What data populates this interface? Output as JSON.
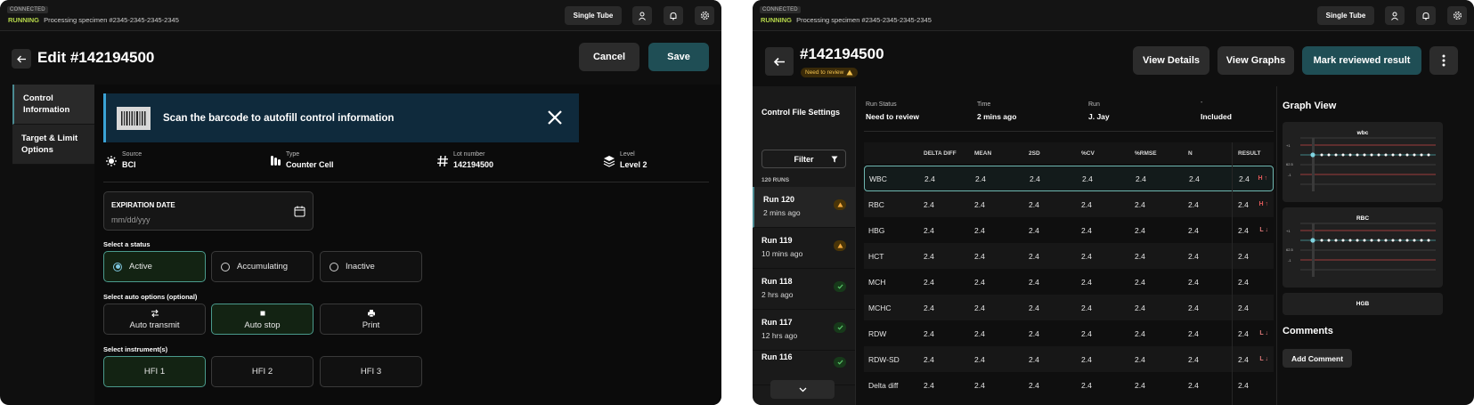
{
  "left": {
    "topbar": {
      "connected": "CONNECTED",
      "running": "RUNNING",
      "status": "Processing specimen #2345-2345-2345-2345",
      "mode_button": "Single Tube"
    },
    "header": {
      "title": "Edit #142194500",
      "cancel": "Cancel",
      "save": "Save"
    },
    "nav": [
      "Control Information",
      "Target & Limit Options"
    ],
    "banner": {
      "text": "Scan the barcode to autofill control information"
    },
    "meta": [
      {
        "label": "Source",
        "value": "BCI",
        "icon": "source-icon"
      },
      {
        "label": "Type",
        "value": "Counter Cell",
        "icon": "tubes-icon"
      },
      {
        "label": "Lot number",
        "value": "142194500",
        "icon": "hash-icon"
      },
      {
        "label": "Level",
        "value": "Level 2",
        "icon": "layers-icon"
      }
    ],
    "expiration": {
      "label": "EXPIRATION DATE",
      "placeholder": "mm/dd/yyy"
    },
    "status": {
      "label": "Select a status",
      "options": [
        "Active",
        "Accumulating",
        "Inactive"
      ],
      "selected": "Active"
    },
    "auto": {
      "label": "Select auto options (optional)",
      "options": [
        "Auto transmit",
        "Auto stop",
        "Print"
      ],
      "selected": "Auto stop"
    },
    "instruments": {
      "label": "Select instrument(s)",
      "options": [
        "HFI 1",
        "HFI 2",
        "HFI 3"
      ],
      "selected": "HFI 1"
    }
  },
  "right": {
    "topbar": {
      "connected": "CONNECTED",
      "running": "RUNNING",
      "status": "Processing specimen #2345-2345-2345-2345",
      "mode_button": "Single Tube"
    },
    "header": {
      "title": "#142194500",
      "badge": "Need to review",
      "view_details": "View Details",
      "view_graphs": "View Graphs",
      "mark_reviewed": "Mark reviewed result"
    },
    "sidebar": {
      "title": "Control File Settings",
      "filter": "Filter",
      "runs_count": "120 RUNS",
      "runs": [
        {
          "name": "Run 120",
          "time": "2 mins ago",
          "status": "warn"
        },
        {
          "name": "Run 119",
          "time": "10 mins ago",
          "status": "warn"
        },
        {
          "name": "Run 118",
          "time": "2 hrs ago",
          "status": "ok"
        },
        {
          "name": "Run 117",
          "time": "12 hrs ago",
          "status": "ok"
        },
        {
          "name": "Run 116",
          "time": "",
          "status": "ok"
        }
      ]
    },
    "info": [
      {
        "label": "Run Status",
        "value": "Need to review"
      },
      {
        "label": "Time",
        "value": "2 mins ago"
      },
      {
        "label": "Run",
        "value": "J. Jay"
      },
      {
        "label": "-",
        "value": "Included"
      }
    ],
    "table": {
      "columns": [
        "DELTA DIFF",
        "MEAN",
        "2SD",
        "%CV",
        "%RMSE",
        "N",
        "RESULT"
      ],
      "rows": [
        {
          "name": "WBC",
          "values": [
            "2.4",
            "2.4",
            "2.4",
            "2.4",
            "2.4",
            "2.4",
            "2.4"
          ],
          "flag": "H ↑"
        },
        {
          "name": "RBC",
          "values": [
            "2.4",
            "2.4",
            "2.4",
            "2.4",
            "2.4",
            "2.4",
            "2.4"
          ],
          "flag": "H ↑"
        },
        {
          "name": "HBG",
          "values": [
            "2.4",
            "2.4",
            "2.4",
            "2.4",
            "2.4",
            "2.4",
            "2.4"
          ],
          "flag": "L ↓"
        },
        {
          "name": "HCT",
          "values": [
            "2.4",
            "2.4",
            "2.4",
            "2.4",
            "2.4",
            "2.4",
            "2.4"
          ],
          "flag": ""
        },
        {
          "name": "MCH",
          "values": [
            "2.4",
            "2.4",
            "2.4",
            "2.4",
            "2.4",
            "2.4",
            "2.4"
          ],
          "flag": ""
        },
        {
          "name": "MCHC",
          "values": [
            "2.4",
            "2.4",
            "2.4",
            "2.4",
            "2.4",
            "2.4",
            "2.4"
          ],
          "flag": ""
        },
        {
          "name": "RDW",
          "values": [
            "2.4",
            "2.4",
            "2.4",
            "2.4",
            "2.4",
            "2.4",
            "2.4"
          ],
          "flag": "L ↓"
        },
        {
          "name": "RDW-SD",
          "values": [
            "2.4",
            "2.4",
            "2.4",
            "2.4",
            "2.4",
            "2.4",
            "2.4"
          ],
          "flag": "L ↓"
        },
        {
          "name": "Delta diff",
          "values": [
            "2.4",
            "2.4",
            "2.4",
            "2.4",
            "2.4",
            "2.4",
            "2.4"
          ],
          "flag": ""
        }
      ]
    },
    "graphs": {
      "title": "Graph View",
      "cards": [
        {
          "name": "wbc",
          "ticks": [
            "+1",
            "62.5",
            "-1"
          ]
        },
        {
          "name": "RBC",
          "ticks": [
            "+1",
            "62.5",
            "-1"
          ]
        },
        {
          "name": "HGB",
          "ticks": []
        }
      ]
    },
    "comments": {
      "title": "Comments",
      "add": "Add Comment"
    }
  }
}
